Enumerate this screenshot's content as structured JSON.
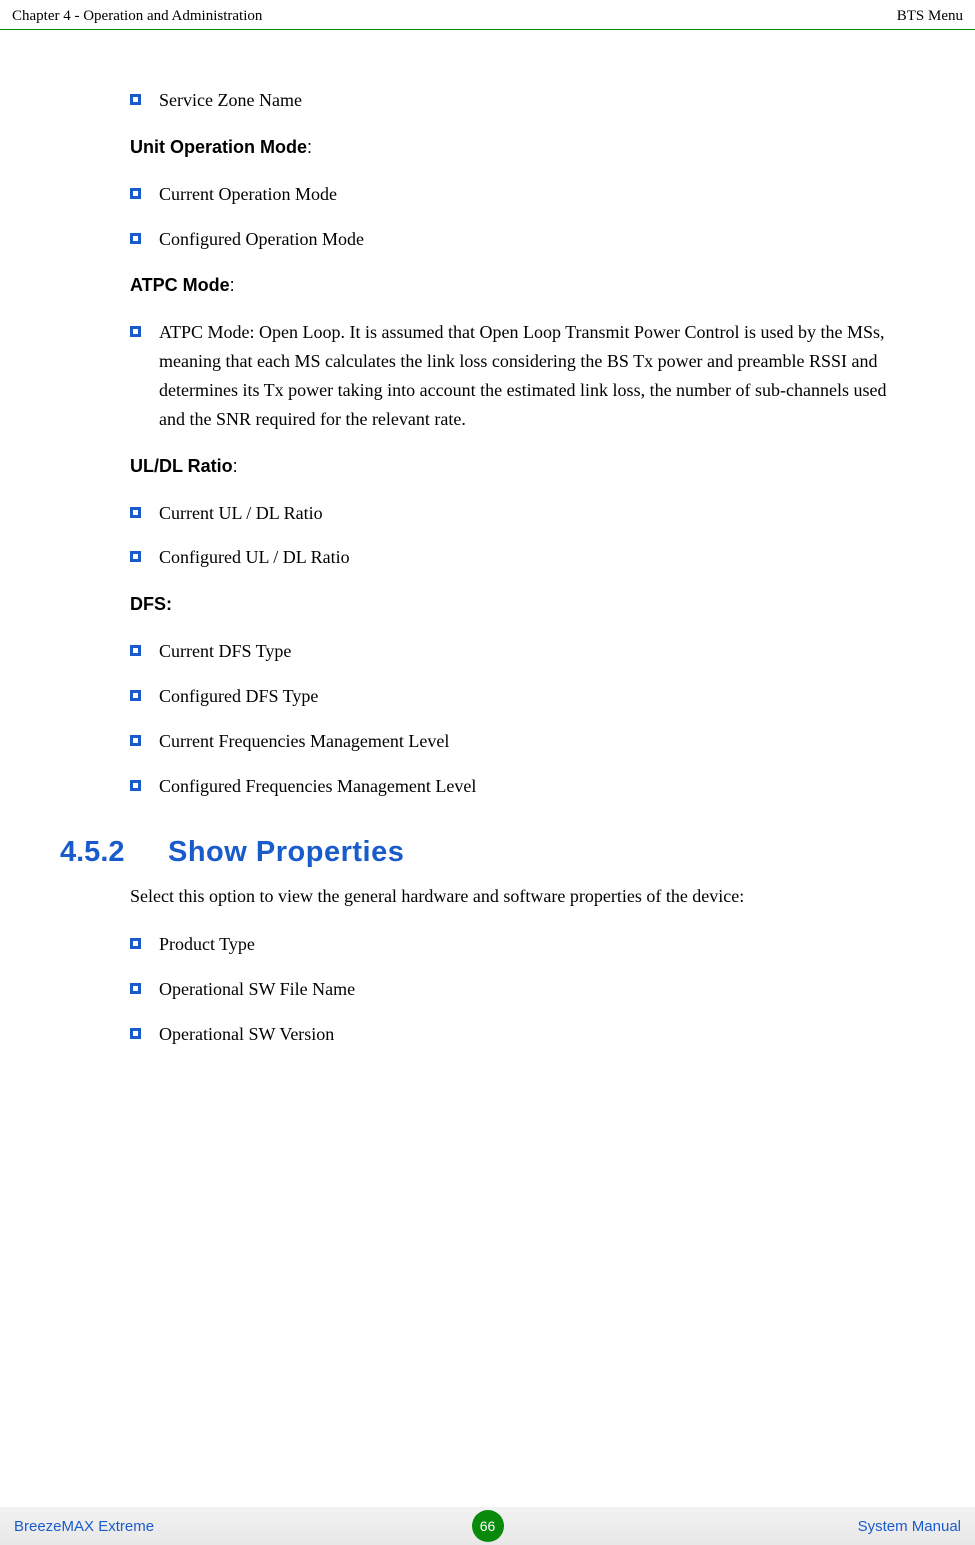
{
  "header": {
    "left": "Chapter 4 - Operation and Administration",
    "right": "BTS Menu"
  },
  "sections": {
    "svc_zone_name": "Service Zone Name",
    "unit_op_mode_label": "Unit Operation Mode",
    "unit_op_mode": {
      "current": "Current Operation Mode",
      "configured": "Configured Operation Mode"
    },
    "atpc_mode_label": "ATPC Mode",
    "atpc_mode_text": "ATPC Mode: Open Loop. It is assumed that Open Loop Transmit Power Control is used by the MSs, meaning that each MS calculates the link loss considering the BS Tx power and preamble RSSI and determines its Tx power taking into account the estimated link loss, the number of sub-channels used and the SNR required for the relevant rate.",
    "uldl_label": "UL/DL Ratio",
    "uldl": {
      "current": "Current UL / DL Ratio",
      "configured": "Configured UL / DL Ratio"
    },
    "dfs_label": "DFS:",
    "dfs": {
      "current_type": "Current DFS Type",
      "configured_type": "Configured DFS Type",
      "current_freq": "Current Frequencies Management Level",
      "configured_freq": "Configured Frequencies Management Level"
    }
  },
  "heading": {
    "num": "4.5.2",
    "title": "Show Properties"
  },
  "show_props": {
    "intro": "Select this option to view the general hardware and software properties of the device:",
    "items": {
      "product_type": "Product Type",
      "op_sw_file": "Operational SW File Name",
      "op_sw_version": "Operational SW Version"
    }
  },
  "footer": {
    "left": "BreezeMAX Extreme",
    "page": "66",
    "right": "System Manual"
  }
}
